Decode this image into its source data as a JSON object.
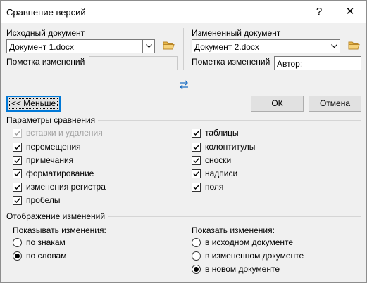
{
  "window": {
    "title": "Сравнение версий",
    "help_label": "?",
    "close_label": "✕"
  },
  "original": {
    "label": "Исходный документ",
    "value": "Документ 1.docx",
    "changes_label": "Пометка изменений",
    "changes_value": ""
  },
  "revised": {
    "label": "Измененный документ",
    "value": "Документ 2.docx",
    "changes_label": "Пометка изменений",
    "changes_value": "Автор:"
  },
  "buttons": {
    "less": "<< Меньше",
    "ok": "ОК",
    "cancel": "Отмена"
  },
  "compare_settings": {
    "title": "Параметры сравнения",
    "left": [
      {
        "label": "вставки и удаления",
        "checked": true,
        "disabled": true
      },
      {
        "label": "перемещения",
        "checked": true
      },
      {
        "label": "примечания",
        "checked": true
      },
      {
        "label": "форматирование",
        "checked": true
      },
      {
        "label": "изменения регистра",
        "checked": true
      },
      {
        "label": "пробелы",
        "checked": true
      }
    ],
    "right": [
      {
        "label": "таблицы",
        "checked": true
      },
      {
        "label": "колонтитулы",
        "checked": true
      },
      {
        "label": "сноски",
        "checked": true
      },
      {
        "label": "надписи",
        "checked": true
      },
      {
        "label": "поля",
        "checked": true
      }
    ]
  },
  "show_changes": {
    "title": "Отображение изменений",
    "level_label": "Показывать изменения:",
    "level_options": [
      {
        "label": "по знакам",
        "selected": false
      },
      {
        "label": "по словам",
        "selected": true
      }
    ],
    "where_label": "Показать изменения:",
    "where_options": [
      {
        "label": "в исходном документе",
        "selected": false
      },
      {
        "label": "в измененном документе",
        "selected": false
      },
      {
        "label": "в новом документе",
        "selected": true
      }
    ]
  }
}
